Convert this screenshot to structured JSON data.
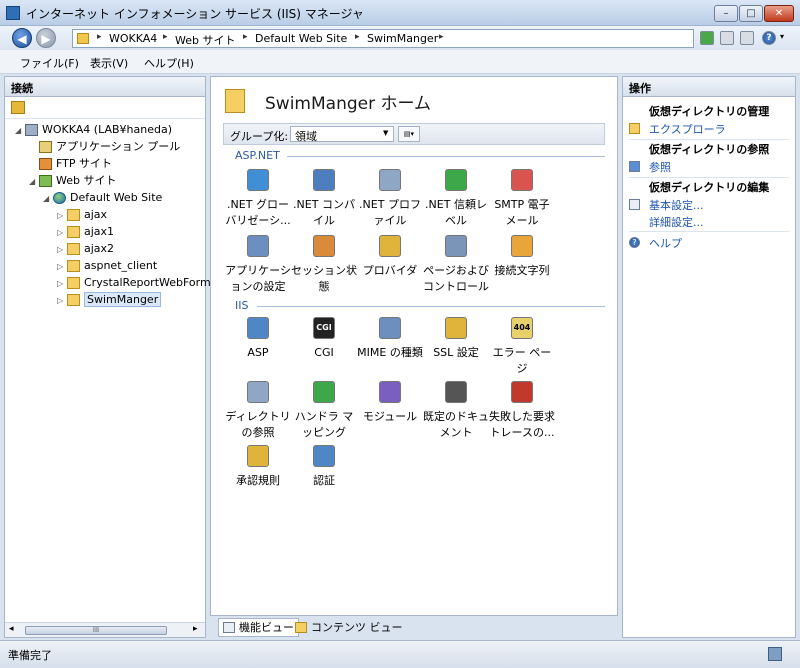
{
  "window": {
    "title": "インターネット インフォメーション サービス (IIS) マネージャ",
    "btn_min": "–",
    "btn_max": "□",
    "btn_close": "✕"
  },
  "nav": {
    "back_glyph": "◀",
    "fwd_glyph": "▶",
    "breadcrumbs": [
      "WOKKA4",
      "Web サイト",
      "Default Web Site",
      "SwimManger"
    ],
    "arrow": "▸",
    "help_glyph": "?",
    "dropdown_glyph": "▾"
  },
  "menu": {
    "items": [
      "ファイル(F)",
      "表示(V)",
      "ヘルプ(H)"
    ]
  },
  "connections": {
    "header": "接続",
    "tree": [
      {
        "label": "WOKKA4 (LAB¥haneda)",
        "icon": "server-icon",
        "toggle": "◢",
        "depth": 0
      },
      {
        "label": "アプリケーション プール",
        "icon": "app-pool-icon",
        "toggle": "",
        "depth": 1
      },
      {
        "label": "FTP サイト",
        "icon": "ftp-icon",
        "toggle": "",
        "depth": 1
      },
      {
        "label": "Web サイト",
        "icon": "websites-icon",
        "toggle": "◢",
        "depth": 1
      },
      {
        "label": "Default Web Site",
        "icon": "globe-icon",
        "toggle": "◢",
        "depth": 2
      },
      {
        "label": "ajax",
        "icon": "folder-app-icon",
        "toggle": "▷",
        "depth": 3
      },
      {
        "label": "ajax1",
        "icon": "folder-app-icon",
        "toggle": "▷",
        "depth": 3
      },
      {
        "label": "ajax2",
        "icon": "folder-app-icon",
        "toggle": "▷",
        "depth": 3
      },
      {
        "label": "aspnet_client",
        "icon": "folder-icon",
        "toggle": "▷",
        "depth": 3
      },
      {
        "label": "CrystalReportWebForm",
        "icon": "folder-app-icon",
        "toggle": "▷",
        "depth": 3
      },
      {
        "label": "SwimManger",
        "icon": "folder-app-icon",
        "toggle": "▷",
        "depth": 3,
        "selected": true
      }
    ],
    "scroll_left": "◂",
    "scroll_right": "▸",
    "scroll_thumb": "III"
  },
  "home": {
    "title": "SwimManger ホーム",
    "group_label": "グループ化:",
    "group_value": "領域",
    "group_arrow": "▼",
    "view_glyph": "▤▾"
  },
  "sections": {
    "aspnet": {
      "title": "ASP.NET",
      "features": [
        {
          "label": ".NET グローバリゼーシ...",
          "icon": "globalization-icon",
          "color": "#3f8fd6"
        },
        {
          "label": ".NET コンパイル",
          "icon": "compilation-icon",
          "color": "#4d7fc0"
        },
        {
          "label": ".NET プロファイル",
          "icon": "profile-icon",
          "color": "#8fa6c4"
        },
        {
          "label": ".NET 信頼レベル",
          "icon": "trust-level-icon",
          "color": "#3ca84a"
        },
        {
          "label": "SMTP 電子メール",
          "icon": "smtp-email-icon",
          "color": "#d9534f"
        },
        {
          "label": "アプリケーションの設定",
          "icon": "app-settings-icon",
          "color": "#6b8fbf"
        },
        {
          "label": "セッション状態",
          "icon": "session-state-icon",
          "color": "#d98a3a"
        },
        {
          "label": "プロバイダ",
          "icon": "providers-icon",
          "color": "#e0b43a"
        },
        {
          "label": "ページおよびコントロール",
          "icon": "pages-controls-icon",
          "color": "#7b95b8"
        },
        {
          "label": "接続文字列",
          "icon": "connection-strings-icon",
          "color": "#e7a53a"
        }
      ]
    },
    "iis": {
      "title": "IIS",
      "features": [
        {
          "label": "ASP",
          "icon": "asp-icon",
          "color": "#4f86c6"
        },
        {
          "label": "CGI",
          "icon": "cgi-icon",
          "color": "#222222",
          "badge": "CGI"
        },
        {
          "label": "MIME の種類",
          "icon": "mime-types-icon",
          "color": "#6c8fbf"
        },
        {
          "label": "SSL 設定",
          "icon": "ssl-icon",
          "color": "#e0b43a"
        },
        {
          "label": "エラー ページ",
          "icon": "error-pages-icon",
          "color": "#e8d06a",
          "badge": "404"
        },
        {
          "label": "ディレクトリの参照",
          "icon": "directory-browsing-icon",
          "color": "#8fa6c4"
        },
        {
          "label": "ハンドラ マッピング",
          "icon": "handler-mappings-icon",
          "color": "#3ca84a"
        },
        {
          "label": "モジュール",
          "icon": "modules-icon",
          "color": "#7a5fc0"
        },
        {
          "label": "既定のドキュメント",
          "icon": "default-document-icon",
          "color": "#555555"
        },
        {
          "label": "失敗した要求トレースの...",
          "icon": "failed-request-tracing-icon",
          "color": "#c0392b"
        },
        {
          "label": "承認規則",
          "icon": "authorization-rules-icon",
          "color": "#e0b43a"
        },
        {
          "label": "認証",
          "icon": "authentication-icon",
          "color": "#4f86c6"
        }
      ]
    }
  },
  "view_tabs": {
    "feature": "機能ビュー",
    "content": "コンテンツ ビュー"
  },
  "actions": {
    "header": "操作",
    "groups": [
      {
        "title": "仮想ディレクトリの管理",
        "links": [
          {
            "label": "エクスプローラ",
            "icon": "explore-icon"
          }
        ]
      },
      {
        "title": "仮想ディレクトリの参照",
        "links": [
          {
            "label": "参照",
            "icon": "browse-icon"
          }
        ]
      },
      {
        "title": "仮想ディレクトリの編集",
        "links": [
          {
            "label": "基本設定...",
            "icon": "basic-settings-icon"
          },
          {
            "label": "詳細設定...",
            "icon": ""
          }
        ]
      }
    ],
    "help": "ヘルプ",
    "help_glyph": "?"
  },
  "status": {
    "text": "準備完了"
  },
  "colors": {
    "accent": "#2c5aa0",
    "link": "#1f56b3"
  }
}
